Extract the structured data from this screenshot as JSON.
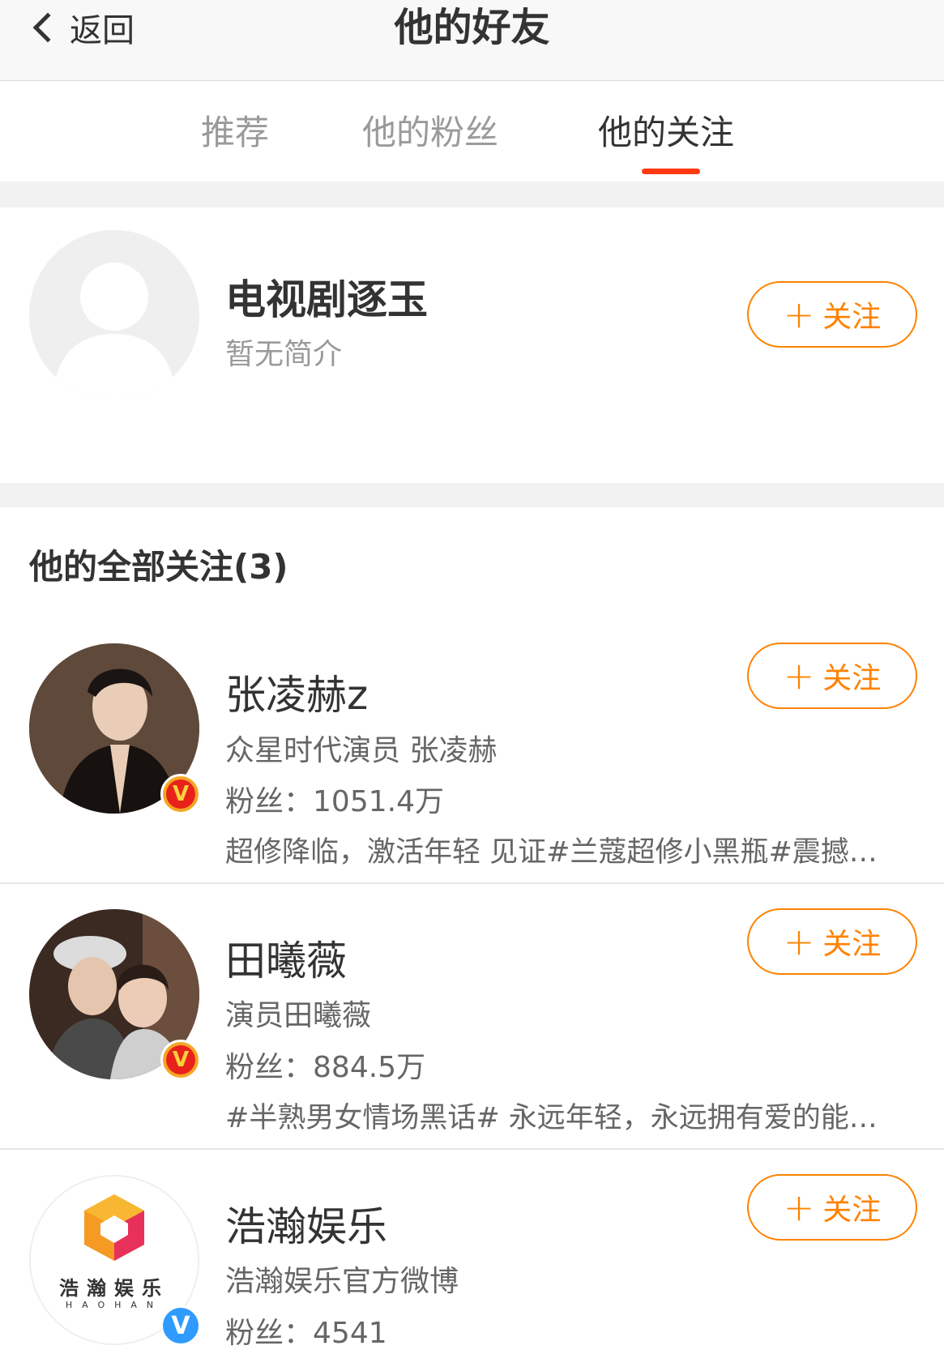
{
  "navbar": {
    "back_label": "返回",
    "title": "他的好友"
  },
  "tabs": [
    {
      "label": "推荐",
      "active": false
    },
    {
      "label": "他的粉丝",
      "active": false
    },
    {
      "label": "他的关注",
      "active": true
    }
  ],
  "accent_color": "#ff8200",
  "tab_indicator_color": "#ff3a12",
  "recommended": {
    "name": "电视剧逐玉",
    "bio": "暂无简介",
    "follow_label": "关注",
    "avatar": "default-avatar-icon"
  },
  "section": {
    "title": "他的全部关注(3)"
  },
  "follows": [
    {
      "name": "张凌赫z",
      "bio": "众星时代演员 张凌赫",
      "fans_label": "粉丝：",
      "fans": "1051.4万",
      "status": "超修降临，激活年轻 见证#兰蔻超修小黑瓶#震撼登...",
      "verified": "gold-v-badge",
      "follow_label": "关注"
    },
    {
      "name": "田曦薇",
      "bio": "演员田曦薇",
      "fans_label": "粉丝：",
      "fans": "884.5万",
      "status": "#半熟男女情场黑话# 永远年轻，永远拥有爱的能力...",
      "verified": "gold-v-badge",
      "follow_label": "关注"
    },
    {
      "name": "浩瀚娱乐",
      "bio": "浩瀚娱乐官方微博",
      "fans_label": "粉丝：",
      "fans": "4541",
      "verified": "blue-v-badge",
      "follow_label": "关注",
      "logo_text": "浩瀚娱乐",
      "logo_subtext": "HAOHAN"
    }
  ]
}
